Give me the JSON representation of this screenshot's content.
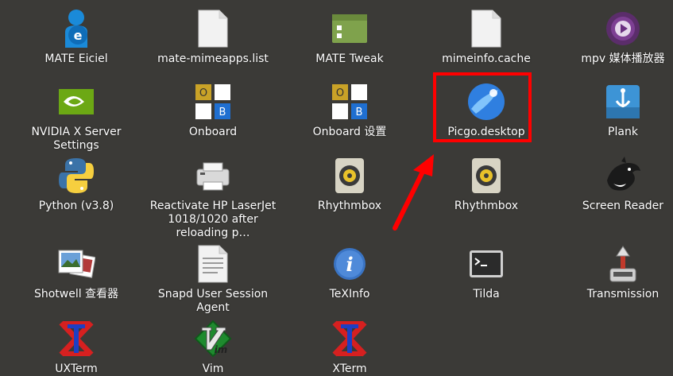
{
  "desktop": {
    "rows": [
      [
        {
          "label": "MATE Eiciel",
          "icon": "mate-eiciel-icon"
        },
        {
          "label": "mate-mimeapps.list",
          "icon": "text-file-icon"
        },
        {
          "label": "MATE Tweak",
          "icon": "mate-tweak-icon"
        },
        {
          "label": "mimeinfo.cache",
          "icon": "text-file-icon"
        },
        {
          "label": "mpv 媒体播放器",
          "icon": "mpv-icon"
        }
      ],
      [
        {
          "label": "NVIDIA X Server Settings",
          "icon": "nvidia-icon"
        },
        {
          "label": "Onboard",
          "icon": "onboard-icon"
        },
        {
          "label": "Onboard 设置",
          "icon": "onboard-icon"
        },
        {
          "label": "Picgo.desktop",
          "icon": "picgo-icon"
        },
        {
          "label": "Plank",
          "icon": "plank-icon"
        }
      ],
      [
        {
          "label": "Python (v3.8)",
          "icon": "python-icon"
        },
        {
          "label": "Reactivate HP LaserJet 1018/1020 after reloading p…",
          "icon": "printer-icon"
        },
        {
          "label": "Rhythmbox",
          "icon": "rhythmbox-icon"
        },
        {
          "label": "Rhythmbox",
          "icon": "rhythmbox-icon"
        },
        {
          "label": "Screen Reader",
          "icon": "orca-icon"
        }
      ],
      [
        {
          "label": "Shotwell 查看器",
          "icon": "shotwell-icon"
        },
        {
          "label": "Snapd User Session Agent",
          "icon": "document-icon"
        },
        {
          "label": "TeXInfo",
          "icon": "info-icon"
        },
        {
          "label": "Tilda",
          "icon": "terminal-icon"
        },
        {
          "label": "Transmission",
          "icon": "transmission-icon"
        }
      ],
      [
        {
          "label": "UXTerm",
          "icon": "xterm-icon"
        },
        {
          "label": "Vim",
          "icon": "vim-icon"
        },
        {
          "label": "XTerm",
          "icon": "xterm-icon"
        }
      ]
    ],
    "onboard_keys": [
      "O",
      "B"
    ],
    "colors": {
      "background": "#3b3a37",
      "highlight": "#ff0000",
      "label": "#ffffff"
    }
  }
}
